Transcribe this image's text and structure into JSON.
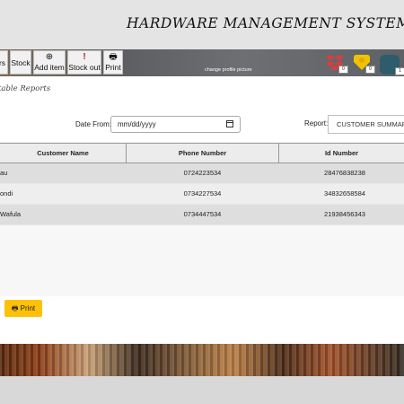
{
  "header": {
    "title": "HARDWARE MANAGEMENT SYSTEM HOME PAG"
  },
  "navbar": {
    "buttons": [
      {
        "label": "rs",
        "icon": ""
      },
      {
        "label": "Stock",
        "icon": ""
      },
      {
        "label": "Add item",
        "icon": "⊕"
      },
      {
        "label": "Stock out",
        "icon": "!"
      },
      {
        "label": "Print",
        "icon": "🖶"
      }
    ],
    "change_picture": "change profile picture",
    "notifications": [
      {
        "icon": "dropbox-icon",
        "count": "0",
        "color": "#e03b3b"
      },
      {
        "icon": "tag-icon",
        "count": "0",
        "color": "#f2c200"
      },
      {
        "icon": "profile-icon",
        "count": "1",
        "color": "#2d5c6c"
      }
    ]
  },
  "main": {
    "title": "table Reports",
    "date_from_label": "Date From:",
    "date_placeholder": "mm/dd/yyyy",
    "report_label": "Report:",
    "report_value": "CUSTOMER SUMMARY"
  },
  "table": {
    "headers": [
      "Customer Name",
      "Phone Number",
      "Id Number"
    ],
    "rows": [
      {
        "name": "au",
        "phone": "0724223534",
        "id": "28476838238"
      },
      {
        "name": "ondi",
        "phone": "0734227534",
        "id": "34832658584"
      },
      {
        "name": "Wafula",
        "phone": "0734447534",
        "id": "21938456343"
      }
    ]
  },
  "print_button": {
    "icon": "🖶",
    "label": "Print"
  }
}
